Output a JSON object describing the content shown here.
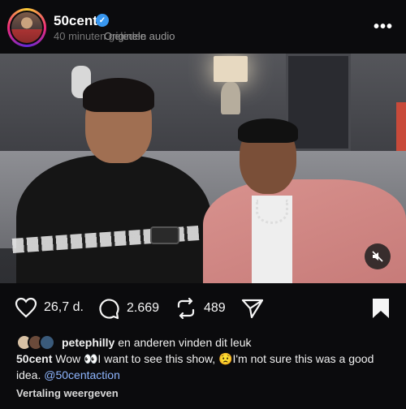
{
  "post": {
    "username": "50cent",
    "time": "40 minuten geleden",
    "audio": "Originele audio"
  },
  "actions": {
    "likes": "26,7 d.",
    "comments": "2.669",
    "reposts": "489"
  },
  "liked_by": {
    "user": "petephilly",
    "rest": "en anderen vinden dit leuk"
  },
  "caption": {
    "author": "50cent",
    "text1": "Wow 👀I want to see this show, 😟I'm not sure this was a good idea.",
    "mention": "@50centaction"
  },
  "translate_label": "Vertaling weergeven",
  "colors": {
    "verified": "#3897f0",
    "mention": "#8fb6ff"
  },
  "icons": [
    "more-icon",
    "heart-icon",
    "comment-icon",
    "repost-icon",
    "share-icon",
    "bookmark-icon",
    "mute-icon"
  ]
}
